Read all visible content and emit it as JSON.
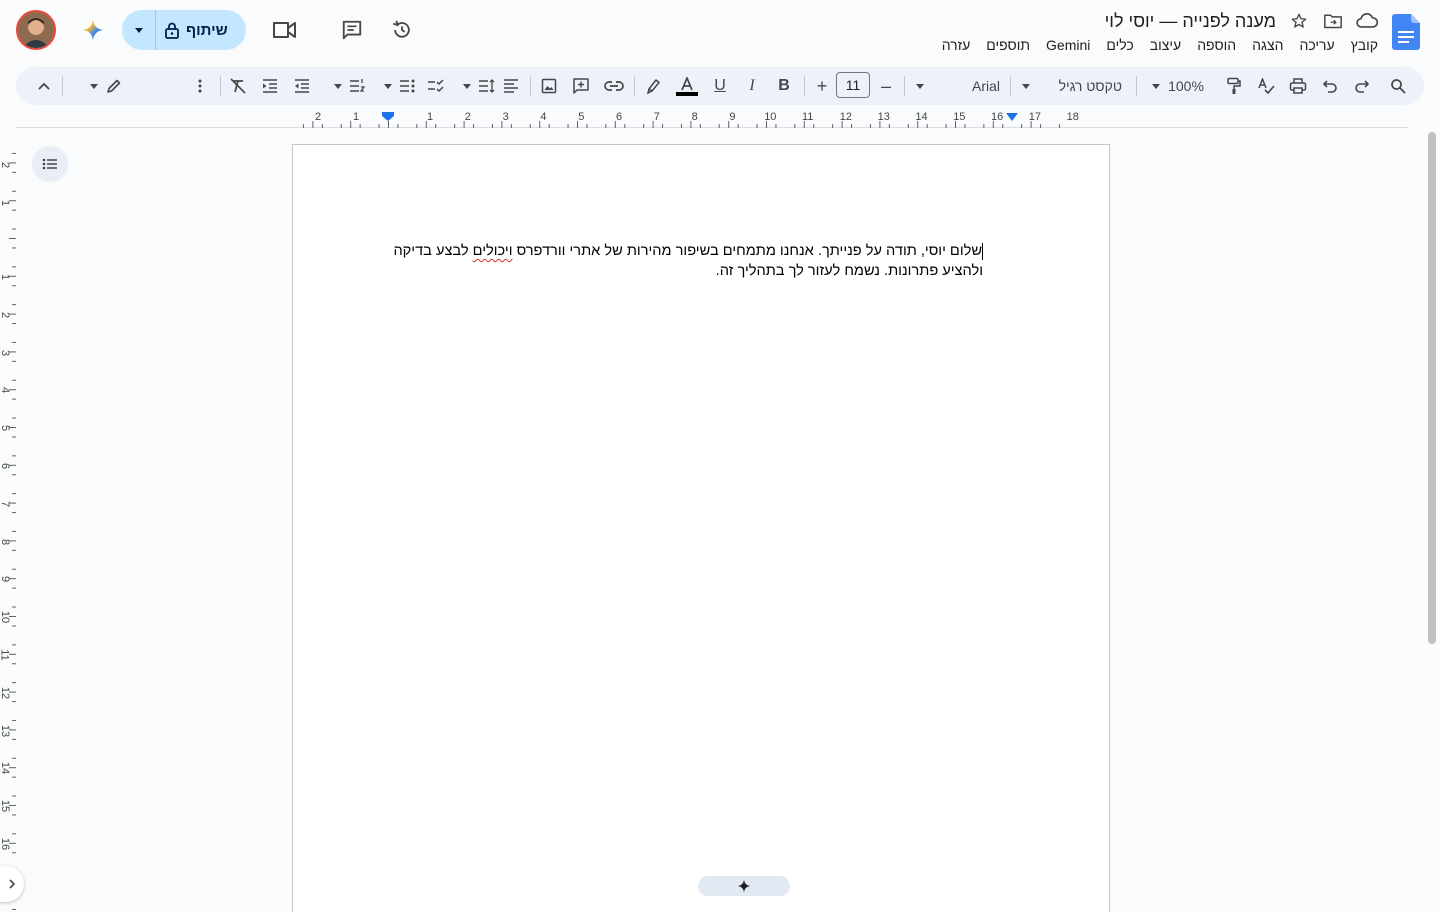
{
  "document": {
    "title": "מענה לפנייה — יוסי לוי",
    "body_before_typo": "שלום יוסי, תודה על פנייתך. אנחנו מתמחים בשיפור מהירות של אתרי וורדפרס ",
    "body_typo": "ויכולים",
    "body_after_typo": " לבצע בדיקה ולהציע פתרונות. נשמח לעזור לך בתהליך זה."
  },
  "menu": {
    "items": [
      "קובץ",
      "עריכה",
      "הצגה",
      "הוספה",
      "עיצוב",
      "כלים",
      "Gemini",
      "תוספים",
      "עזרה"
    ]
  },
  "header": {
    "share_label": "שיתוף"
  },
  "toolbar": {
    "zoom": "100%",
    "style": "טקסט רגיל",
    "font": "Arial",
    "font_size": "11"
  },
  "ruler": {
    "horizontal": [
      "2",
      "1",
      "1",
      "2",
      "3",
      "4",
      "5",
      "6",
      "7",
      "8",
      "9",
      "10",
      "11",
      "12",
      "13",
      "14",
      "15",
      "16",
      "17",
      "18"
    ],
    "vertical": [
      "2",
      "1",
      "1",
      "2",
      "3",
      "4",
      "5",
      "6",
      "7",
      "8",
      "9",
      "10",
      "11",
      "12",
      "13",
      "14",
      "15",
      "16"
    ]
  },
  "colors": {
    "accent": "#1a73e8",
    "share_bg": "#c2e7ff",
    "toolbar_bg": "#edf2fa",
    "typo_underline": "#d93025"
  },
  "icons": {
    "doc_logo": "docs-logo-icon",
    "star": "star-icon",
    "move": "folder-move-icon",
    "cloud": "cloud-saved-icon",
    "history": "history-icon",
    "comments": "comment-icon",
    "meet": "video-call-icon",
    "lock": "lock-icon",
    "gemini": "gemini-sparkle-icon"
  }
}
